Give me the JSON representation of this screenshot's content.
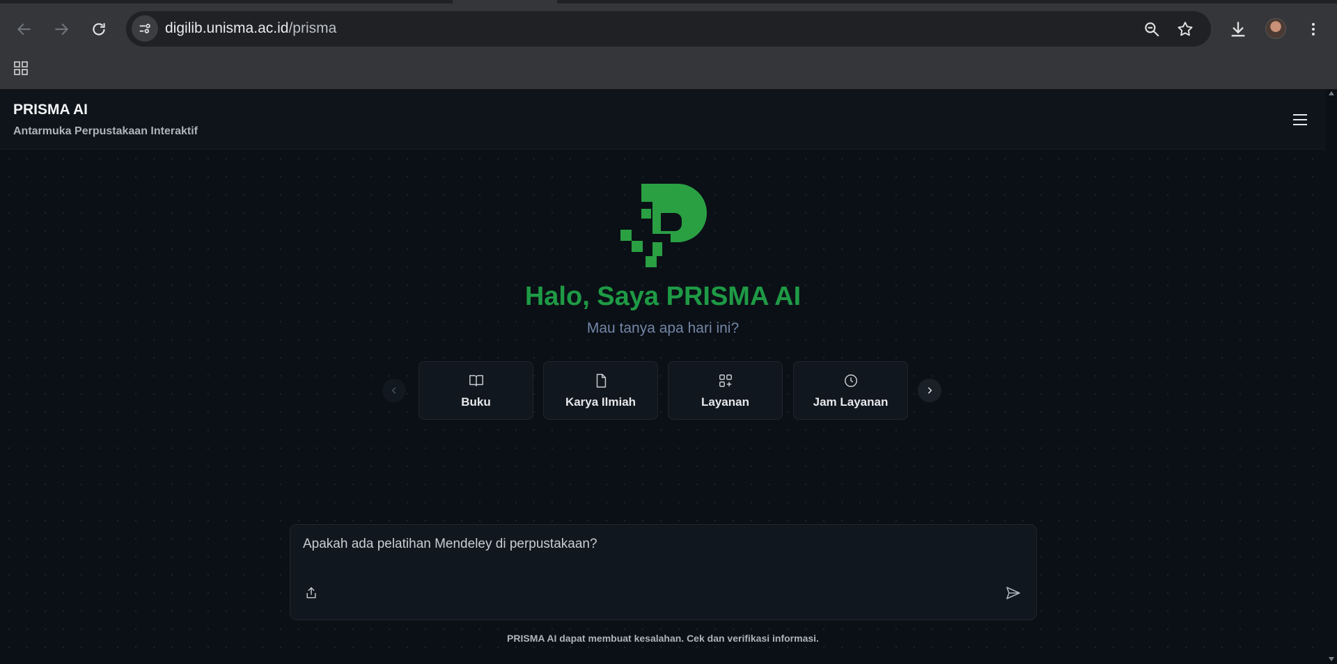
{
  "browser": {
    "url_host": "digilib.unisma.ac.id",
    "url_path": "/prisma",
    "icons": [
      "back-icon",
      "forward-icon",
      "reload-icon",
      "site-info-icon",
      "zoom-icon",
      "bookmark-star-icon",
      "download-icon",
      "avatar",
      "more-icon",
      "apps-icon"
    ]
  },
  "header": {
    "title": "PRISMA AI",
    "subtitle": "Antarmuka Perpustakaan Interaktif"
  },
  "hero": {
    "greeting": "Halo, Saya PRISMA AI",
    "prompt": "Mau tanya apa hari ini?"
  },
  "quick_actions": [
    {
      "label": "Buku",
      "icon": "book-icon"
    },
    {
      "label": "Karya Ilmiah",
      "icon": "document-icon"
    },
    {
      "label": "Layanan",
      "icon": "grid-plus-icon"
    },
    {
      "label": "Jam Layanan",
      "icon": "clock-icon"
    }
  ],
  "chat_input": {
    "value": "Apakah ada pelatihan Mendeley di perpustakaan?"
  },
  "disclaimer": "PRISMA AI dapat membuat kesalahan. Cek dan verifikasi informasi.",
  "colors": {
    "brand_green": "#1e9a45",
    "logo_green": "#2aa043",
    "background": "#0b1016",
    "card_bg": "#11171e",
    "subtext": "#7386a6"
  }
}
